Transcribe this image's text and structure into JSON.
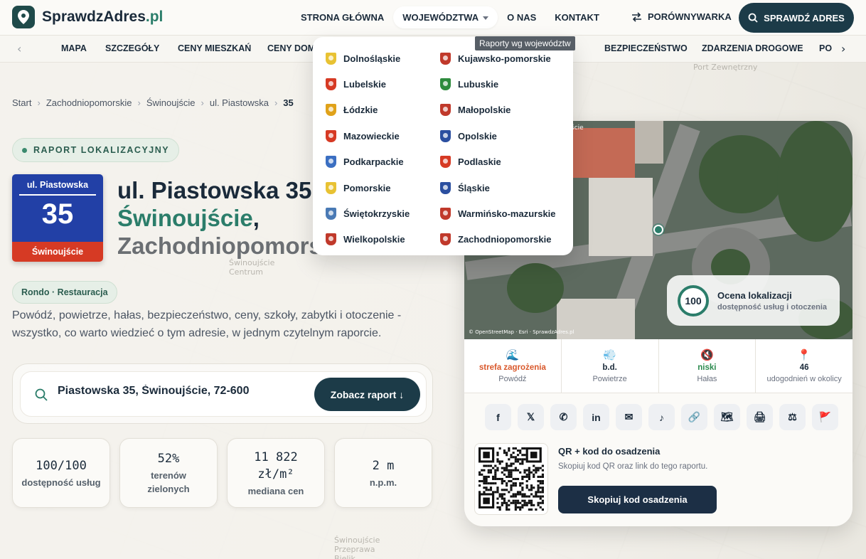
{
  "header": {
    "logo_main": "SprawdzAdres",
    "logo_tld": ".pl",
    "nav": [
      {
        "label": "STRONA GŁÓWNA"
      },
      {
        "label": "WOJEWÓDZTWA"
      },
      {
        "label": "O NAS"
      },
      {
        "label": "KONTAKT"
      }
    ],
    "compare_label": "PORÓWNYWARKA",
    "check_label": "SPRAWDŹ ADRES"
  },
  "subnav": {
    "items": [
      "MAPA",
      "SZCZEGÓŁY",
      "CENY MIESZKAŃ",
      "CENY DOM",
      "BEZPIECZEŃSTWO",
      "ZDARZENIA DROGOWE",
      "PO"
    ]
  },
  "tooltip": "Raporty wg województw",
  "dropdown": {
    "items": [
      {
        "label": "Dolnośląskie",
        "color": "#e8c233"
      },
      {
        "label": "Kujawsko-pomorskie",
        "color": "#c0392b"
      },
      {
        "label": "Lubelskie",
        "color": "#d63a24"
      },
      {
        "label": "Lubuskie",
        "color": "#2e8b3d"
      },
      {
        "label": "Łódzkie",
        "color": "#e0a21a"
      },
      {
        "label": "Małopolskie",
        "color": "#c0392b"
      },
      {
        "label": "Mazowieckie",
        "color": "#d63a24"
      },
      {
        "label": "Opolskie",
        "color": "#2b4fa0"
      },
      {
        "label": "Podkarpackie",
        "color": "#3b6fc2"
      },
      {
        "label": "Podlaskie",
        "color": "#d63a24"
      },
      {
        "label": "Pomorskie",
        "color": "#e8c233"
      },
      {
        "label": "Śląskie",
        "color": "#2b4fa0"
      },
      {
        "label": "Świętokrzyskie",
        "color": "#4a7ab5"
      },
      {
        "label": "Warmińsko-mazurskie",
        "color": "#c0392b"
      },
      {
        "label": "Wielkopolskie",
        "color": "#c0392b"
      },
      {
        "label": "Zachodniopomorskie",
        "color": "#c0392b"
      }
    ]
  },
  "breadcrumb": [
    "Start",
    "Zachodniopomorskie",
    "Świnoujście",
    "ul. Piastowska",
    "35"
  ],
  "report_pill": "RAPORT LOKALIZACYJNY",
  "sign": {
    "street": "ul. Piastowska",
    "number": "35",
    "city": "Świnoujście"
  },
  "title": {
    "line1": "ul. Piastowska 35",
    "line2": "Świnoujście",
    "comma": ",",
    "line3": "Zachodniopomorskie"
  },
  "tag": "Rondo · Restauracja",
  "intro": "Powódź, powietrze, hałas, bezpieczeństwo, ceny, szkoły, zabytki i otoczenie - wszystko, co warto wiedzieć o tym adresie, w jednym czytelnym raporcie.",
  "search": {
    "value": "Piastowska 35, Świnoujście, 72-600",
    "button": "Zobacz raport ↓"
  },
  "stats": [
    {
      "value": "100/100",
      "label": "dostępność usług"
    },
    {
      "value": "52%",
      "label": "terenów zielonych"
    },
    {
      "value": "11 822 zł/m²",
      "label": "mediana cen"
    },
    {
      "value": "2 m",
      "label": "n.p.m."
    }
  ],
  "map": {
    "attribution": "© OpenStreetMap · Esri · SprawdzAdres.pl",
    "label": "ście"
  },
  "score": {
    "value": "100",
    "title": "Ocena lokalizacji",
    "subtitle": "dostępność usług i otoczenia"
  },
  "metrics": [
    {
      "icon": "🌊",
      "value": "strefa zagrożenia",
      "label": "Powódź",
      "color": "#d9582b"
    },
    {
      "icon": "💨",
      "value": "b.d.",
      "label": "Powietrze",
      "color": "#1a2a3a"
    },
    {
      "icon": "🔇",
      "value": "niski",
      "label": "Hałas",
      "color": "#2b8a4e"
    },
    {
      "icon": "📍",
      "value": "46",
      "label": "udogodnień w okolicy",
      "color": "#1a2a3a"
    }
  ],
  "share": [
    "f",
    "𝕏",
    "✆",
    "in",
    "✉",
    "♪",
    "🔗",
    "🗺",
    "🖨",
    "⚖",
    "🚩"
  ],
  "share_names": [
    "facebook-icon",
    "x-icon",
    "whatsapp-icon",
    "linkedin-icon",
    "email-icon",
    "tiktok-icon",
    "link-icon",
    "map-icon",
    "print-icon",
    "compare-icon",
    "flag-icon"
  ],
  "qr": {
    "title": "QR + kod do osadzenia",
    "subtitle": "Skopiuj kod QR oraz link do tego raportu.",
    "button": "Skopiuj kod osadzenia"
  },
  "bg_labels": [
    "Port Zewnętrzny",
    "Świnoujście Centrum",
    "Świnoujście Przeprawa Bielik"
  ]
}
